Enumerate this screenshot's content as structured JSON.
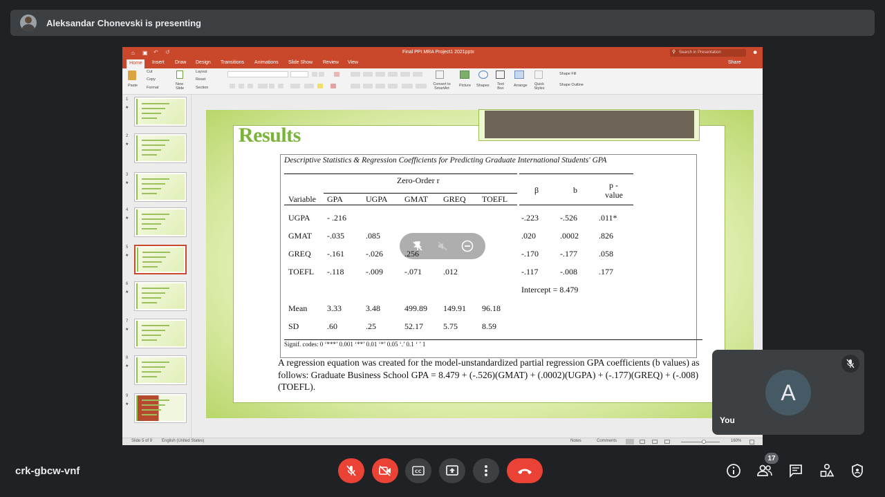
{
  "presenter": {
    "text": "Aleksandar Chonevski is presenting"
  },
  "ppt": {
    "filename": "Final PPt MRA Project1 2021pptx",
    "search_placeholder": "Search in Presentation",
    "share_label": "Share",
    "tabs": [
      "Home",
      "Insert",
      "Draw",
      "Design",
      "Transitions",
      "Animations",
      "Slide Show",
      "Review",
      "View"
    ],
    "ribbon": {
      "paste": "Paste",
      "cut": "Cut",
      "copy": "Copy",
      "format": "Format",
      "new_slide": "New Slide",
      "layout": "Layout",
      "reset": "Reset",
      "section": "Section",
      "convert_smartart": "Convert to SmartArt",
      "picture": "Picture",
      "shapes": "Shapes",
      "text_box": "Text Box",
      "arrange": "Arrange",
      "quick_styles": "Quick Styles",
      "shape_fill": "Shape Fill",
      "shape_outline": "Shape Outline"
    },
    "thumbnails": [
      "1",
      "2",
      "3",
      "4",
      "5",
      "6",
      "7",
      "8",
      "9"
    ],
    "status": {
      "slide_of": "Slide 5 of 9",
      "language": "English (United States)",
      "notes": "Notes",
      "comments": "Comments",
      "zoom": "160%"
    }
  },
  "slide": {
    "title": "Results",
    "table": {
      "caption": "Descriptive Statistics & Regression Coefficients for Predicting Graduate International Students' GPA",
      "group_header": "Zero-Order r",
      "headers": [
        "Variable",
        "GPA",
        "UGPA",
        "GMAT",
        "GREQ",
        "TOEFL"
      ],
      "beta_header": "β",
      "b_header": "b",
      "p_header_1": "p -",
      "p_header_2": "value",
      "rows": [
        {
          "var": "UGPA",
          "gpa": "- .216",
          "ugpa": "",
          "gmat": "",
          "greq": "",
          "toefl": "",
          "beta": "-.223",
          "b": "-.526",
          "p": ".011*"
        },
        {
          "var": "GMAT",
          "gpa": "-.035",
          "ugpa": ".085",
          "gmat": "",
          "greq": "",
          "toefl": "",
          "beta": ".020",
          "b": ".0002",
          "p": ".826"
        },
        {
          "var": "GREQ",
          "gpa": "-.161",
          "ugpa": "-.026",
          "gmat": ".256",
          "greq": "",
          "toefl": "",
          "beta": "-.170",
          "b": "-.177",
          "p": ".058"
        },
        {
          "var": "TOEFL",
          "gpa": "-.118",
          "ugpa": "-.009",
          "gmat": "-.071",
          "greq": ".012",
          "toefl": "",
          "beta": "-.117",
          "b": "-.008",
          "p": ".177"
        }
      ],
      "intercept": "Intercept = 8.479",
      "mean": {
        "var": "Mean",
        "gpa": "3.33",
        "ugpa": "3.48",
        "gmat": "499.89",
        "greq": "149.91",
        "toefl": "96.18"
      },
      "sd": {
        "var": "SD",
        "gpa": ".60",
        "ugpa": ".25",
        "gmat": "52.17",
        "greq": "5.75",
        "toefl": "8.59"
      },
      "signif": "Signif. codes:  0 ‘***’ 0.001 ‘**’ 0.01 ‘*’ 0.05 ‘.’ 0.1 ‘ ’ 1"
    },
    "paragraph": "A regression equation was created for the model-unstandardized partial regression GPA coefficients (b values) as follows: Graduate Business School GPA = 8.479 + (-.526)(GMAT) + (.0002)(UGPA) + (-.177)(GREQ) + (-.008)(TOEFL)."
  },
  "self_tile": {
    "avatar_letter": "A",
    "label": "You"
  },
  "meeting": {
    "code": "crk-gbcw-vnf",
    "participant_count": "17"
  },
  "icons": [
    "mic-off-icon",
    "camera-off-icon",
    "captions-icon",
    "present-icon",
    "more-icon",
    "end-call-icon",
    "info-icon",
    "people-icon",
    "chat-icon",
    "activities-icon",
    "host-controls-icon"
  ],
  "colors": {
    "end_call": "#ea4335",
    "ppt_brand": "#c9482b",
    "slide_accent": "#7bb33a"
  }
}
